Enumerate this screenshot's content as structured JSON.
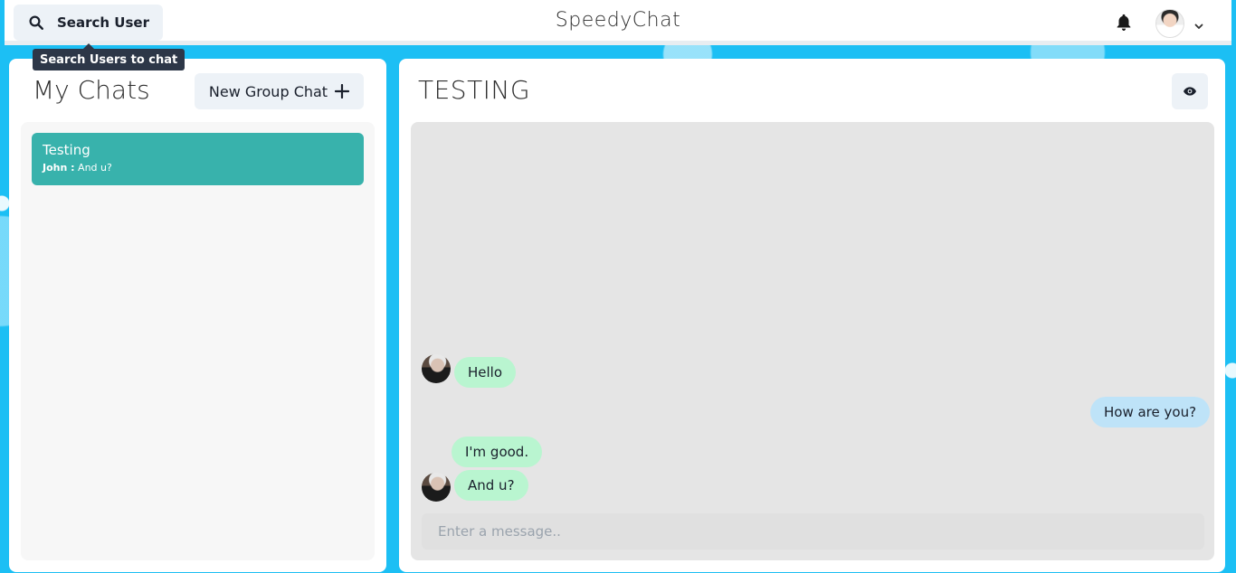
{
  "header": {
    "search_label": "Search User",
    "brand": "SpeedyChat",
    "tooltip": "Search Users to chat"
  },
  "left": {
    "title": "My Chats",
    "new_group_label": "New Group Chat",
    "chats": [
      {
        "name": "Testing",
        "sender": "John :",
        "last_message": "And u?"
      }
    ]
  },
  "room": {
    "title": "TESTING",
    "messages": [
      {
        "text": "Hello",
        "direction": "in"
      },
      {
        "text": "How are you?",
        "direction": "out"
      },
      {
        "text": "I'm good.",
        "direction": "in"
      },
      {
        "text": "And u?",
        "direction": "in"
      }
    ],
    "input_placeholder": "Enter a message.."
  },
  "colors": {
    "background": "#1cbff4",
    "selected_chat": "#38b2ac",
    "incoming_bubble": "#b9f5d0",
    "outgoing_bubble": "#bee3f8",
    "tooltip": "#2d3748"
  },
  "icons": {
    "search": "search-icon",
    "bell": "bell-icon",
    "chevron": "chevron-down-icon",
    "plus": "plus-icon",
    "eye": "eye-icon"
  }
}
